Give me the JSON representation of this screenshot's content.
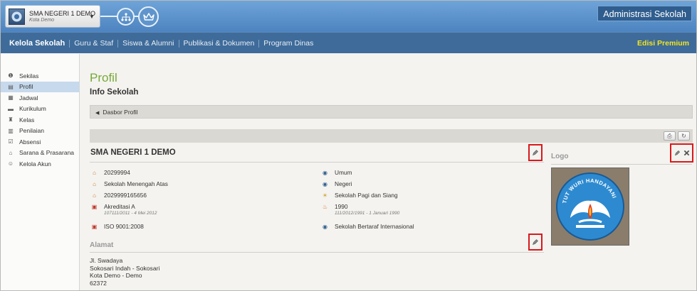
{
  "header": {
    "school_name": "SMA NEGERI 1 DEMO",
    "school_city": "Kota Demo",
    "app_title": "Administrasi Sekolah"
  },
  "nav": {
    "items": [
      "Kelola Sekolah",
      "Guru & Staf",
      "Siswa & Alumni",
      "Publikasi & Dokumen",
      "Program Dinas"
    ],
    "premium": "Edisi Premium"
  },
  "sidebar": {
    "items": [
      {
        "label": "Sekilas",
        "icon": "info-icon"
      },
      {
        "label": "Profil",
        "icon": "profile-card-icon",
        "active": true
      },
      {
        "label": "Jadwal",
        "icon": "calendar-icon"
      },
      {
        "label": "Kurikulum",
        "icon": "book-icon"
      },
      {
        "label": "Kelas",
        "icon": "class-icon"
      },
      {
        "label": "Penilaian",
        "icon": "grade-icon"
      },
      {
        "label": "Absensi",
        "icon": "checklist-icon"
      },
      {
        "label": "Sarana & Prasarana",
        "icon": "building-icon"
      },
      {
        "label": "Kelola Akun",
        "icon": "users-icon"
      }
    ]
  },
  "main": {
    "title": "Profil",
    "subtitle": "Info Sekolah",
    "breadcrumb": "Dasbor Profil",
    "school_title": "SMA NEGERI 1 DEMO",
    "left_info": [
      {
        "value": "20299994",
        "icon": "school-icon"
      },
      {
        "value": "Sekolah Menengah Atas",
        "icon": "school-icon"
      },
      {
        "value": "2029999165656",
        "icon": "school-icon"
      },
      {
        "value": "Akreditasi A",
        "sub": "107111/2011 - 4 Mei 2012",
        "icon": "certificate-icon"
      },
      {
        "value": "ISO 9001:2008",
        "icon": "certificate-icon"
      }
    ],
    "right_info": [
      {
        "value": "Umum",
        "icon": "emblem-icon"
      },
      {
        "value": "Negeri",
        "icon": "emblem-icon"
      },
      {
        "value": "Sekolah Pagi dan Siang",
        "icon": "sun-icon"
      },
      {
        "value": "1990",
        "sub": "111/2012/1991 - 1 Januari 1990",
        "icon": "cake-icon"
      },
      {
        "value": "Sekolah Bertaraf Internasional",
        "icon": "emblem-icon"
      }
    ],
    "alamat_title": "Alamat",
    "address_lines": [
      "Jl. Swadaya",
      "Sokosari Indah - Sokosari",
      "Kota Demo - Demo",
      "62372"
    ],
    "logo_title": "Logo",
    "logo_text": "TUT WURI HANDAYANI"
  },
  "colors": {
    "topbar": "#5c93cc",
    "nav": "#3e6b9a",
    "accent_green": "#77a93a",
    "premium_yellow": "#f2e51e",
    "highlight_red": "#d9191c"
  }
}
